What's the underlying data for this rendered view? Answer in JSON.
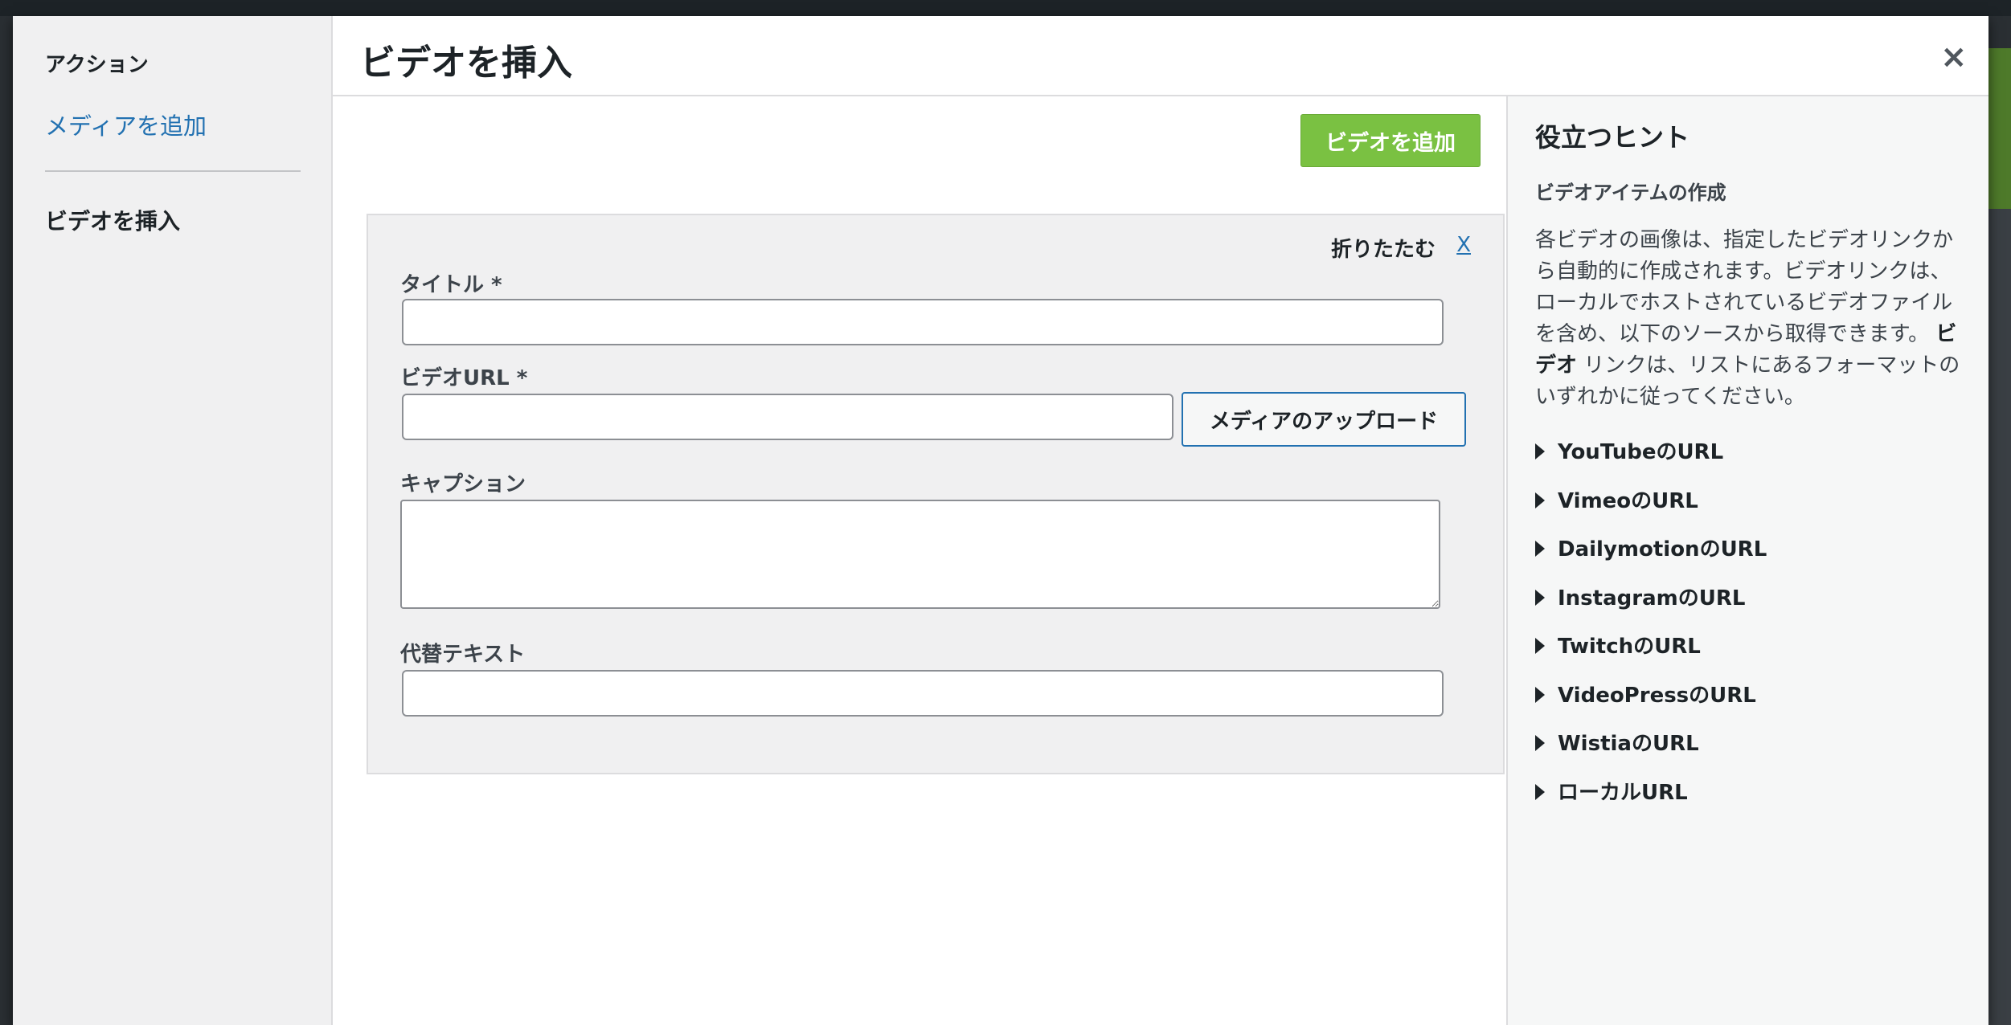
{
  "menu": {
    "heading": "アクション",
    "add_media": "メディアを追加",
    "current": "ビデオを挿入"
  },
  "modal": {
    "title": "ビデオを挿入",
    "close": "×"
  },
  "content": {
    "add_video_button": "ビデオを追加",
    "item": {
      "collapse": "折りたたむ",
      "remove": "X",
      "title_label": "タイトル *",
      "title_value": "",
      "video_url_label": "ビデオURL *",
      "video_url_value": "",
      "upload_button": "メディアのアップロード",
      "caption_label": "キャプション",
      "caption_value": "",
      "alt_label": "代替テキスト",
      "alt_value": ""
    }
  },
  "hints": {
    "title": "役立つヒント",
    "subtitle": "ビデオアイテムの作成",
    "text_part1": "各ビデオの画像は、指定したビデオリンクから自動的に作成されます。ビデオリンクは、ローカルでホストされているビデオファイルを含め、以下のソースから取得できます。",
    "text_bold": "ビデオ",
    "text_part2": "リンクは、リストにあるフォーマットのいずれかに従ってください。",
    "items": [
      "YouTubeのURL",
      "VimeoのURL",
      "DailymotionのURL",
      "InstagramのURL",
      "TwitchのURL",
      "VideoPressのURL",
      "WistiaのURL",
      "ローカルURL"
    ]
  },
  "colors": {
    "accent_green": "#7ac142",
    "link_blue": "#2271b1"
  }
}
